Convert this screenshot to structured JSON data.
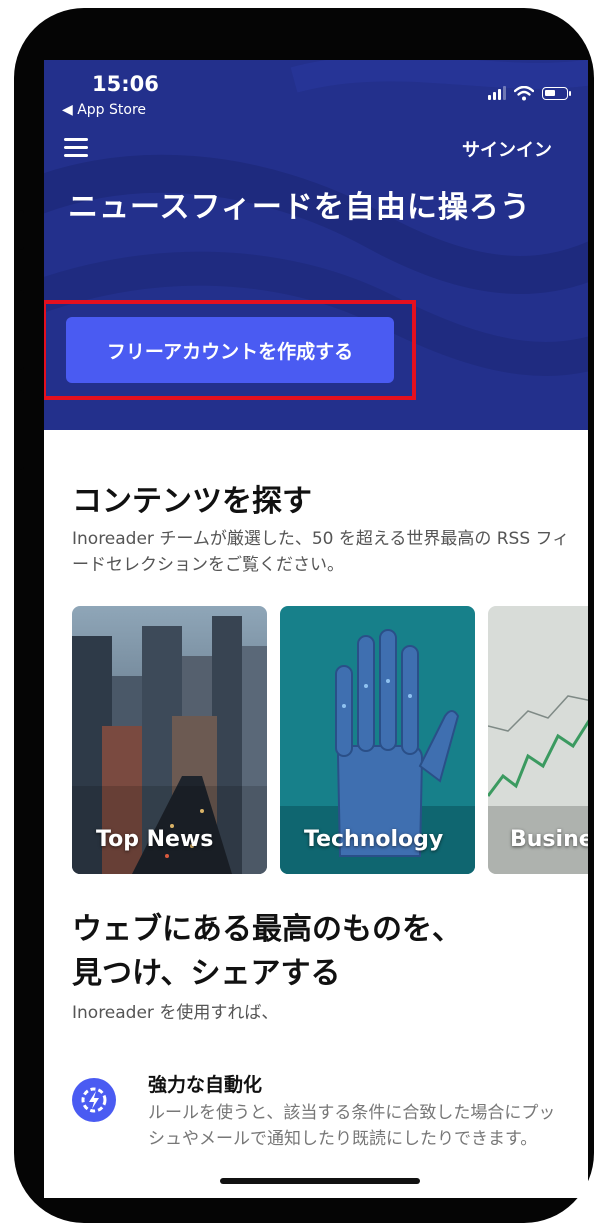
{
  "status_bar": {
    "time": "15:06",
    "back_label": "◀ App Store"
  },
  "header": {
    "menu_icon": "hamburger-menu-icon",
    "signin_label": "サインイン"
  },
  "hero": {
    "headline": "ニュースフィードを自由に操ろう",
    "cta_label": "フリーアカウントを作成する",
    "colors": {
      "background": "#23308c",
      "cta": "#4a5bf2",
      "highlight": "#e4101f"
    }
  },
  "discover": {
    "title": "コンテンツを探す",
    "description": "Inoreader チームが厳選した、50 を超える世界最高の RSS フィードセレクションをご覧ください。",
    "cards": [
      {
        "label": "Top News"
      },
      {
        "label": "Technology"
      },
      {
        "label": "Busine"
      }
    ]
  },
  "web_section": {
    "title_line1": "ウェブにある最高のものを、",
    "title_line2": "見つけ、シェアする",
    "description": "Inoreader を使用すれば、"
  },
  "feature": {
    "icon": "gear-lightning-icon",
    "title": "強力な自動化",
    "description": "ルールを使うと、該当する条件に合致した場合にプッシュやメールで通知したり既読にしたりできます。"
  }
}
